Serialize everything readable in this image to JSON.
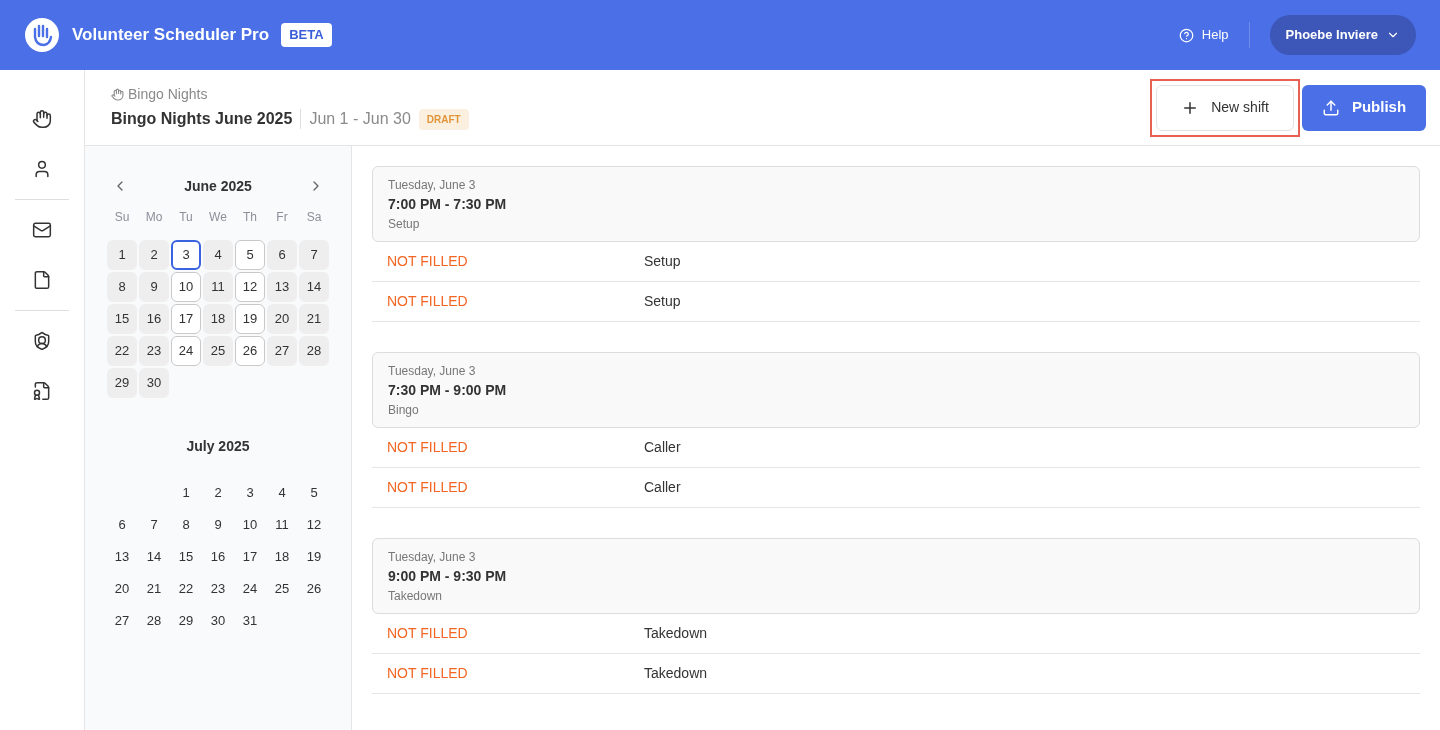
{
  "app": {
    "name": "Volunteer Scheduler Pro",
    "badge": "BETA",
    "help": "Help",
    "user": "Phoebe Inviere"
  },
  "page": {
    "breadcrumb": "Bingo Nights",
    "title": "Bingo Nights June 2025",
    "range": "Jun 1 - Jun 30",
    "status": "DRAFT",
    "new_shift": {
      "label": "New shift",
      "highlighted": true
    },
    "publish": "Publish"
  },
  "weekdays": [
    "Su",
    "Mo",
    "Tu",
    "We",
    "Th",
    "Fr",
    "Sa"
  ],
  "months": [
    {
      "title": "June 2025",
      "days": [
        {
          "label": "1",
          "selected": false,
          "has_shift": false
        },
        {
          "label": "2",
          "selected": false,
          "has_shift": false
        },
        {
          "label": "3",
          "selected": true,
          "has_shift": true
        },
        {
          "label": "4",
          "selected": false,
          "has_shift": false
        },
        {
          "label": "5",
          "selected": false,
          "has_shift": true
        },
        {
          "label": "6",
          "selected": false,
          "has_shift": false
        },
        {
          "label": "7",
          "selected": false,
          "has_shift": false
        },
        {
          "label": "8",
          "selected": false,
          "has_shift": false
        },
        {
          "label": "9",
          "selected": false,
          "has_shift": false
        },
        {
          "label": "10",
          "selected": false,
          "has_shift": true
        },
        {
          "label": "11",
          "selected": false,
          "has_shift": false
        },
        {
          "label": "12",
          "selected": false,
          "has_shift": true
        },
        {
          "label": "13",
          "selected": false,
          "has_shift": false
        },
        {
          "label": "14",
          "selected": false,
          "has_shift": false
        },
        {
          "label": "15",
          "selected": false,
          "has_shift": false
        },
        {
          "label": "16",
          "selected": false,
          "has_shift": false
        },
        {
          "label": "17",
          "selected": false,
          "has_shift": true
        },
        {
          "label": "18",
          "selected": false,
          "has_shift": false
        },
        {
          "label": "19",
          "selected": false,
          "has_shift": true
        },
        {
          "label": "20",
          "selected": false,
          "has_shift": false
        },
        {
          "label": "21",
          "selected": false,
          "has_shift": false
        },
        {
          "label": "22",
          "selected": false,
          "has_shift": false
        },
        {
          "label": "23",
          "selected": false,
          "has_shift": false
        },
        {
          "label": "24",
          "selected": false,
          "has_shift": true
        },
        {
          "label": "25",
          "selected": false,
          "has_shift": false
        },
        {
          "label": "26",
          "selected": false,
          "has_shift": true
        },
        {
          "label": "27",
          "selected": false,
          "has_shift": false
        },
        {
          "label": "28",
          "selected": false,
          "has_shift": false
        },
        {
          "label": "29",
          "selected": false,
          "has_shift": false
        },
        {
          "label": "30",
          "selected": false,
          "has_shift": false
        }
      ],
      "in_range": true
    },
    {
      "title": "July 2025",
      "days": [
        {
          "label": "1"
        },
        {
          "label": "2"
        },
        {
          "label": "3"
        },
        {
          "label": "4"
        },
        {
          "label": "5"
        },
        {
          "label": "6"
        },
        {
          "label": "7"
        },
        {
          "label": "8"
        },
        {
          "label": "9"
        },
        {
          "label": "10"
        },
        {
          "label": "11"
        },
        {
          "label": "12"
        },
        {
          "label": "13"
        },
        {
          "label": "14"
        },
        {
          "label": "15"
        },
        {
          "label": "16"
        },
        {
          "label": "17"
        },
        {
          "label": "18"
        },
        {
          "label": "19"
        },
        {
          "label": "20"
        },
        {
          "label": "21"
        },
        {
          "label": "22"
        },
        {
          "label": "23"
        },
        {
          "label": "24"
        },
        {
          "label": "25"
        },
        {
          "label": "26"
        },
        {
          "label": "27"
        },
        {
          "label": "28"
        },
        {
          "label": "29"
        },
        {
          "label": "30"
        },
        {
          "label": "31"
        }
      ],
      "in_range": false
    }
  ],
  "shifts": [
    {
      "date": "Tuesday, June 3",
      "time": "7:00 PM - 7:30 PM",
      "name": "Setup",
      "slots": [
        {
          "status": "NOT FILLED",
          "role": "Setup"
        },
        {
          "status": "NOT FILLED",
          "role": "Setup"
        }
      ]
    },
    {
      "date": "Tuesday, June 3",
      "time": "7:30 PM - 9:00 PM",
      "name": "Bingo",
      "slots": [
        {
          "status": "NOT FILLED",
          "role": "Caller"
        },
        {
          "status": "NOT FILLED",
          "role": "Caller"
        }
      ]
    },
    {
      "date": "Tuesday, June 3",
      "time": "9:00 PM - 9:30 PM",
      "name": "Takedown",
      "slots": [
        {
          "status": "NOT FILLED",
          "role": "Takedown"
        },
        {
          "status": "NOT FILLED",
          "role": "Takedown"
        }
      ]
    }
  ]
}
